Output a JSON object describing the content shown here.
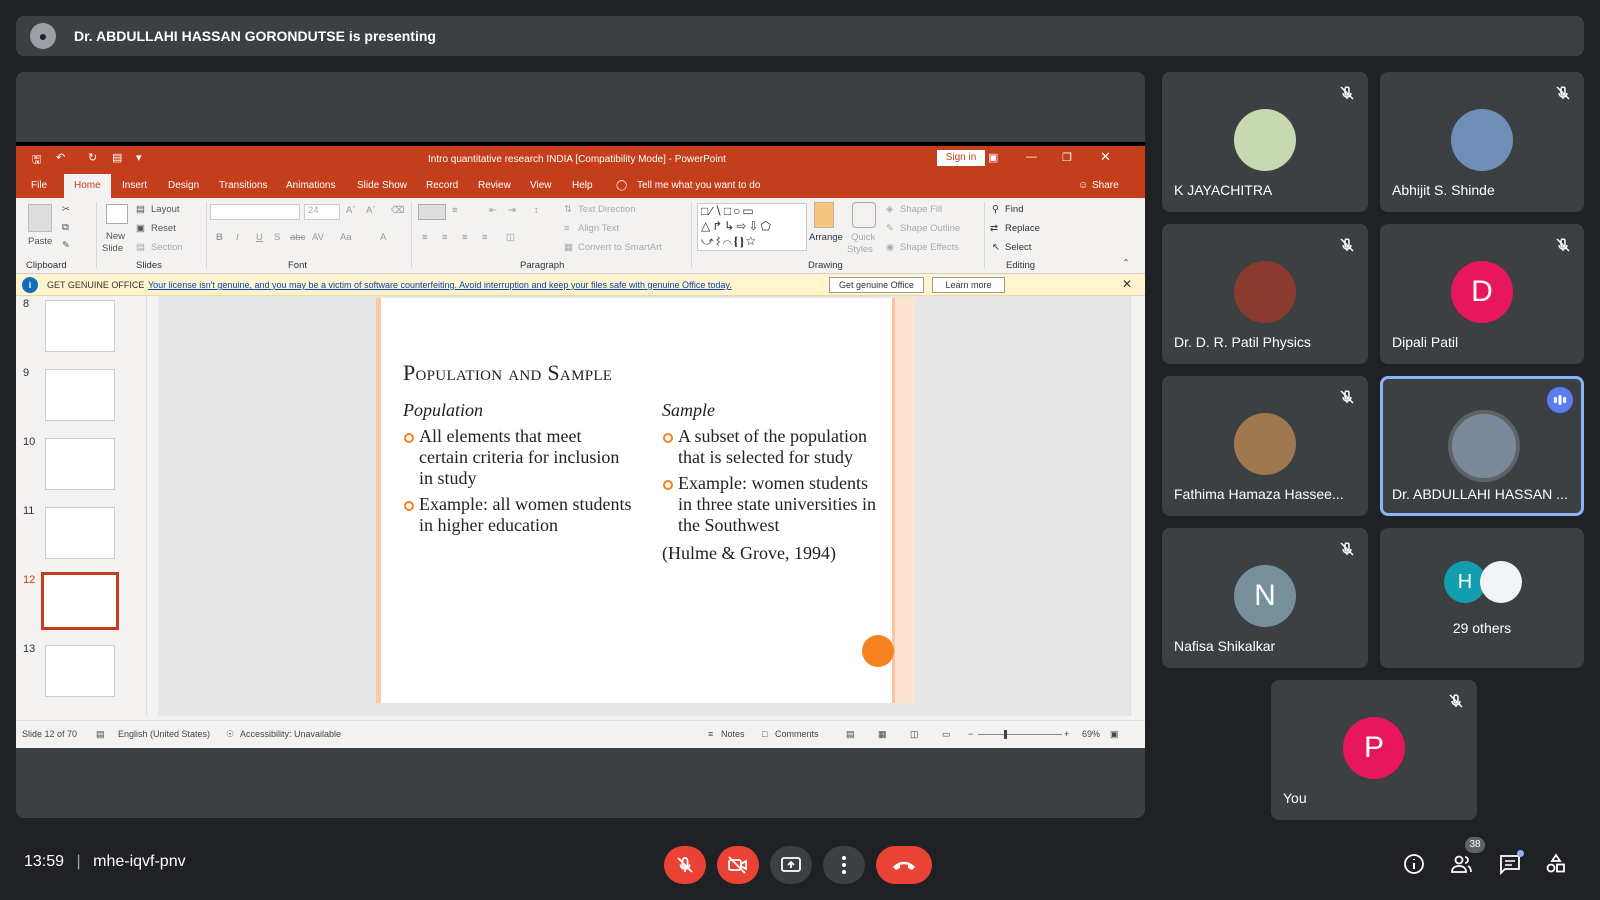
{
  "banner": {
    "presenter_text": "Dr. ABDULLAHI HASSAN GORONDUTSE is presenting"
  },
  "ppt": {
    "title": "Intro quantitative research INDIA [Compatibility Mode]  -  PowerPoint",
    "sign_in": "Sign in",
    "menu": [
      "File",
      "Home",
      "Insert",
      "Design",
      "Transitions",
      "Animations",
      "Slide Show",
      "Record",
      "Review",
      "View",
      "Help"
    ],
    "tell_me": "Tell me what you want to do",
    "share": "Share",
    "ribbon": {
      "paste": "Paste",
      "clipboard": "Clipboard",
      "new_slide": "New",
      "new_slide2": "Slide",
      "layout": "Layout",
      "reset": "Reset",
      "section": "Section",
      "slides": "Slides",
      "font_size": "24",
      "font": "Font",
      "text_direction": "Text Direction",
      "align_text": "Align Text",
      "convert_smartart": "Convert to SmartArt",
      "paragraph": "Paragraph",
      "arrange": "Arrange",
      "quick_styles": "Quick",
      "quick_styles2": "Styles",
      "shape_fill": "Shape Fill",
      "shape_outline": "Shape Outline",
      "shape_effects": "Shape Effects",
      "drawing": "Drawing",
      "find": "Find",
      "replace": "Replace",
      "select": "Select",
      "editing": "Editing"
    },
    "license": {
      "label": "GET GENUINE OFFICE",
      "message": "Your license isn't genuine, and you may be a victim of software counterfeiting. Avoid interruption and keep your files safe with genuine Office today.",
      "btn_genuine": "Get genuine Office",
      "btn_learn": "Learn more"
    },
    "thumb_numbers": [
      "8",
      "9",
      "10",
      "11",
      "12",
      "13"
    ],
    "slide": {
      "title": "Population and Sample",
      "left_heading": "Population",
      "left_bullets": [
        "All elements that meet certain criteria for inclusion in study",
        "Example: all women students in higher education"
      ],
      "right_heading": "Sample",
      "right_bullets": [
        "A subset of the population that is selected for study",
        "Example: women students in three state universities in the Southwest"
      ],
      "citation": "(Hulme & Grove, 1994)"
    },
    "status": {
      "slide_of": "Slide 12 of 70",
      "language": "English (United States)",
      "accessibility": "Accessibility: Unavailable",
      "notes": "Notes",
      "comments": "Comments",
      "zoom": "69%"
    }
  },
  "participants": [
    {
      "name": "K JAYACHITRA"
    },
    {
      "name": "Abhijit S. Shinde"
    },
    {
      "name": "Dr. D. R. Patil Physics"
    },
    {
      "name": "Dipali Patil",
      "initial": "D",
      "color": "#e8175d"
    },
    {
      "name": "Fathima Hamaza Hassee..."
    },
    {
      "name": "Dr. ABDULLAHI HASSAN ..."
    },
    {
      "name": "Nafisa Shikalkar",
      "initial": "N",
      "color": "#78909c"
    },
    {
      "name": "29 others",
      "initial": "H",
      "color": "#129eaf"
    },
    {
      "name": "You",
      "initial": "P",
      "color": "#e8175d"
    }
  ],
  "bottom": {
    "time": "13:59",
    "meeting_code": "mhe-iqvf-pnv",
    "people_count": "38"
  }
}
